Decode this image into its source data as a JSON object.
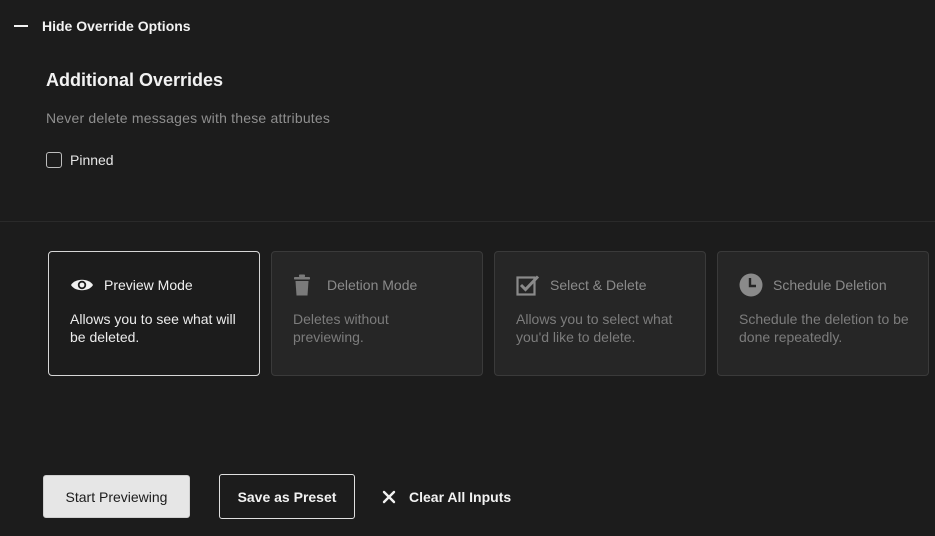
{
  "toggle": {
    "label": "Hide Override Options",
    "icon": "minus-icon"
  },
  "overrides": {
    "title": "Additional Overrides",
    "description": "Never delete messages with these attributes",
    "options": [
      {
        "label": "Pinned",
        "checked": false
      }
    ]
  },
  "modes": [
    {
      "title": "Preview Mode",
      "description": "Allows you to see what will be deleted.",
      "icon": "eye-icon",
      "active": true
    },
    {
      "title": "Deletion Mode",
      "description": "Deletes without previewing.",
      "icon": "trash-icon",
      "active": false
    },
    {
      "title": "Select & Delete",
      "description": "Allows you to select what you'd like to delete.",
      "icon": "checked-box-icon",
      "active": false
    },
    {
      "title": "Schedule Deletion",
      "description": "Schedule the deletion to be done repeatedly.",
      "icon": "clock-icon",
      "active": false
    }
  ],
  "actions": {
    "start_label": "Start Previewing",
    "preset_label": "Save as Preset",
    "clear_label": "Clear All Inputs",
    "clear_icon": "close-icon"
  },
  "colors": {
    "background": "#1c1c1c",
    "card_inactive": "#262626",
    "primary_button": "#e6e6e6"
  }
}
